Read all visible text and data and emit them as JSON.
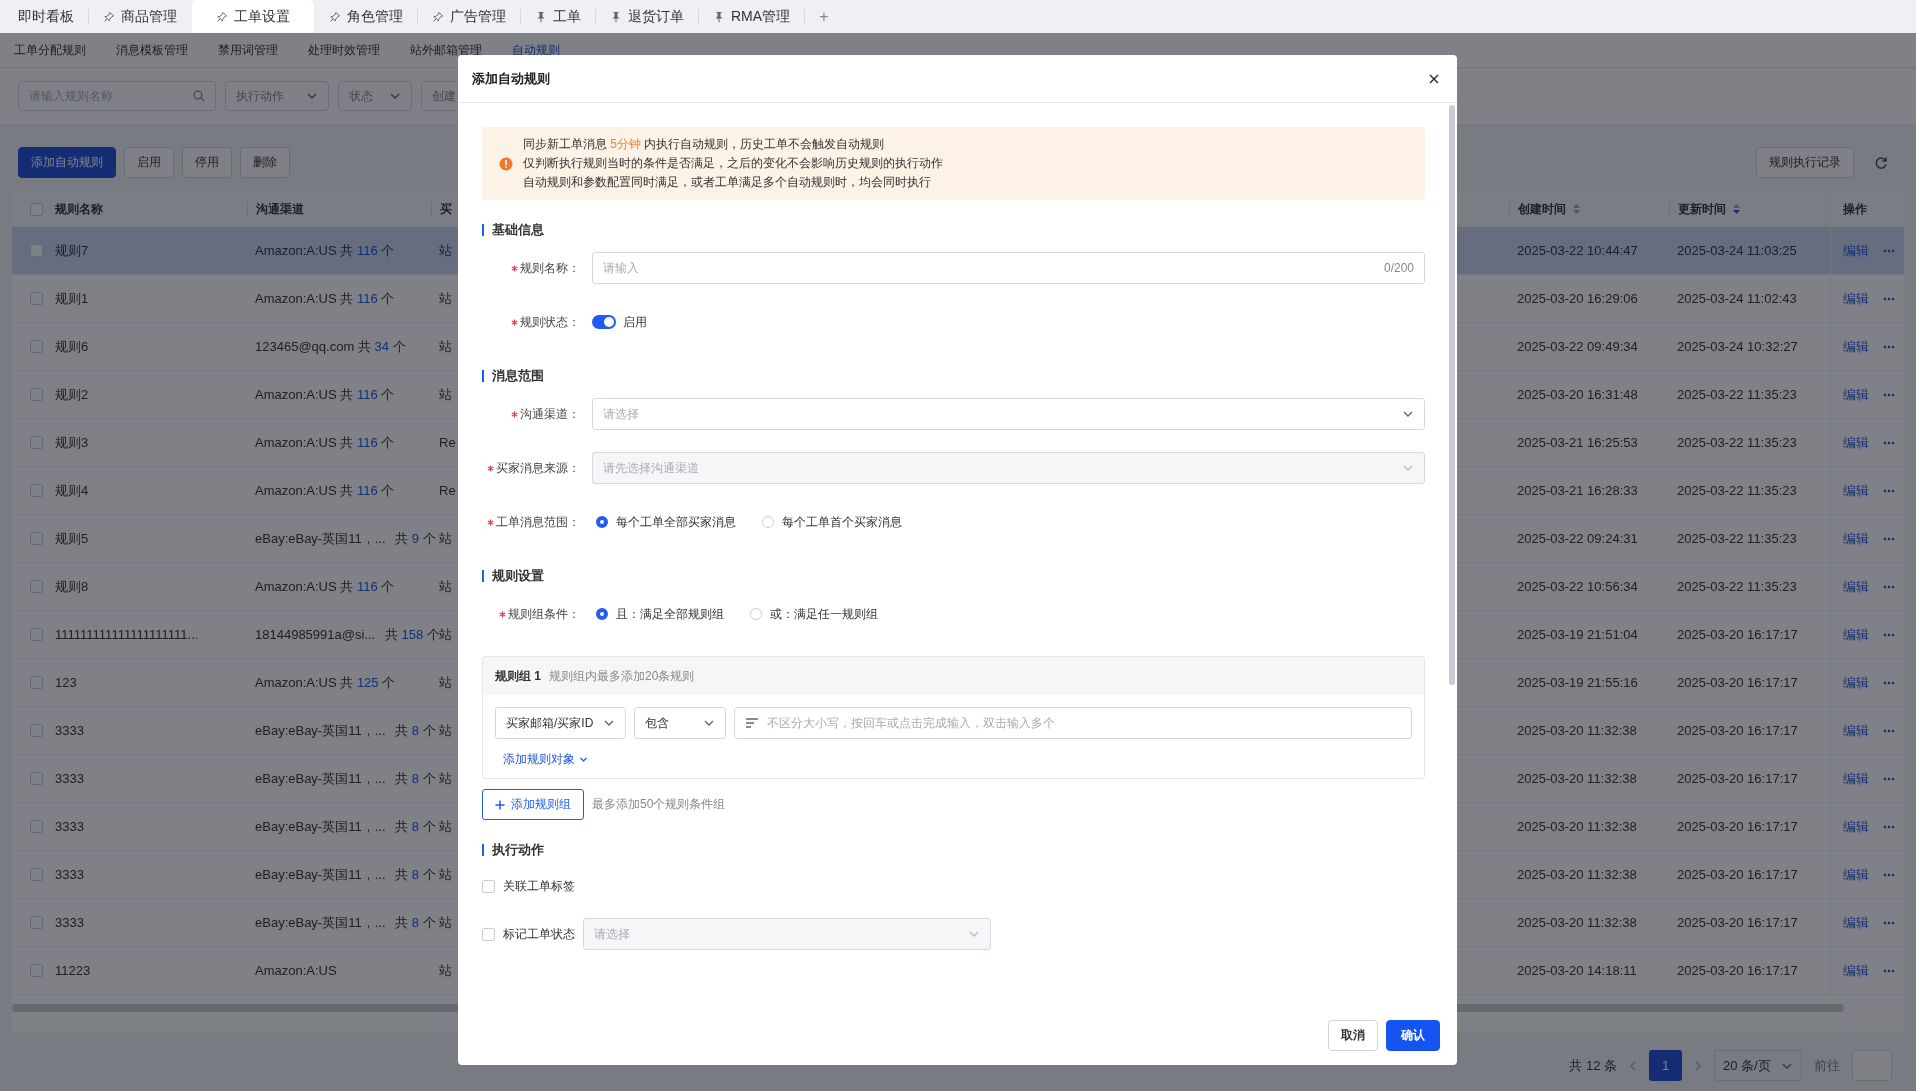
{
  "tabs": [
    {
      "label": "即时看板",
      "selected": false
    },
    {
      "label": "商品管理",
      "pinned": false,
      "selected": false
    },
    {
      "label": "工单设置",
      "pinned": false,
      "selected": true
    },
    {
      "label": "角色管理",
      "pinned": false,
      "selected": false
    },
    {
      "label": "广告管理",
      "pinned": false,
      "selected": false
    },
    {
      "label": "工单",
      "pinned": true,
      "selected": false
    },
    {
      "label": "退货订单",
      "pinned": true,
      "selected": false
    },
    {
      "label": "RMA管理",
      "pinned": true,
      "selected": false
    }
  ],
  "add_tab": "+",
  "subnav": [
    {
      "label": "工单分配规则",
      "selected": false
    },
    {
      "label": "消息模板管理",
      "selected": false
    },
    {
      "label": "禁用词管理",
      "selected": false
    },
    {
      "label": "处理时效管理",
      "selected": false
    },
    {
      "label": "站外邮箱管理",
      "selected": false
    },
    {
      "label": "自动规则",
      "selected": true
    }
  ],
  "filters": {
    "search": {
      "placeholder": "请输入规则名称"
    },
    "dropdowns": [
      {
        "placeholder": "执行动作"
      },
      {
        "placeholder": "状态"
      },
      {
        "placeholder": "创建",
        "cut_off": true
      }
    ]
  },
  "actions": {
    "buttons": [
      {
        "label": "添加自动规则",
        "kind": "primary"
      },
      {
        "label": "启用",
        "kind": "default"
      },
      {
        "label": "停用",
        "kind": "default"
      },
      {
        "label": "删除",
        "kind": "default"
      }
    ],
    "log_button": "规则执行记录"
  },
  "table": {
    "all_checked": false,
    "columns": [
      {
        "label": "规则名称"
      },
      {
        "label": "沟通渠道"
      },
      {
        "label": "买"
      },
      {
        "label": "创建时间",
        "sorted": false
      },
      {
        "label": "更新时间",
        "sorted": true
      },
      {
        "label": "操作"
      }
    ],
    "rows": [
      {
        "name": "规则7",
        "channel": "Amazon:A:US",
        "total": {
          "prefix": "共",
          "count": "116",
          "unit": "个"
        },
        "column_3": "站",
        "created": "2025-03-22 10:44:47",
        "updated": "2025-03-24 11:03:25",
        "edit": "编辑",
        "checked": false,
        "highlighted": true
      },
      {
        "name": "规则1",
        "channel": "Amazon:A:US",
        "total": {
          "prefix": "共",
          "count": "116",
          "unit": "个"
        },
        "column_3": "站",
        "created": "2025-03-20 16:29:06",
        "updated": "2025-03-24 11:02:43",
        "edit": "编辑",
        "checked": false,
        "highlighted": false
      },
      {
        "name": "规则6",
        "channel": "123465@qq.com",
        "total": {
          "prefix": "共",
          "count": "34",
          "unit": "个"
        },
        "column_3": "站",
        "created": "2025-03-22 09:49:34",
        "updated": "2025-03-24 10:32:27",
        "edit": "编辑",
        "checked": false,
        "highlighted": false
      },
      {
        "name": "规则2",
        "channel": "Amazon:A:US",
        "total": {
          "prefix": "共",
          "count": "116",
          "unit": "个"
        },
        "column_3": "站",
        "created": "2025-03-20 16:31:48",
        "updated": "2025-03-22 11:35:23",
        "edit": "编辑",
        "checked": false,
        "highlighted": false
      },
      {
        "name": "规则3",
        "channel": "Amazon:A:US",
        "total": {
          "prefix": "共",
          "count": "116",
          "unit": "个"
        },
        "column_3": "Re",
        "created": "2025-03-21 16:25:53",
        "updated": "2025-03-22 11:35:23",
        "edit": "编辑",
        "checked": false,
        "highlighted": false
      },
      {
        "name": "规则4",
        "channel": "Amazon:A:US",
        "total": {
          "prefix": "共",
          "count": "116",
          "unit": "个"
        },
        "column_3": "Re",
        "created": "2025-03-21 16:28:33",
        "updated": "2025-03-22 11:35:23",
        "edit": "编辑",
        "checked": false,
        "highlighted": false
      },
      {
        "name": "规则5",
        "channel": "eBay:eBay-英国11，...",
        "total": {
          "prefix": "共",
          "count": "9",
          "unit": "个"
        },
        "column_3": "站",
        "created": "2025-03-22 09:24:31",
        "updated": "2025-03-22 11:35:23",
        "edit": "编辑",
        "checked": false,
        "highlighted": false
      },
      {
        "name": "规则8",
        "channel": "Amazon:A:US",
        "total": {
          "prefix": "共",
          "count": "116",
          "unit": "个"
        },
        "column_3": "站",
        "created": "2025-03-22 10:56:34",
        "updated": "2025-03-22 11:35:23",
        "edit": "编辑",
        "checked": false,
        "highlighted": false
      },
      {
        "name": "111111111111111111111...",
        "channel": "18144985991a@si...",
        "total": {
          "prefix": "共",
          "count": "158",
          "unit": "个"
        },
        "column_3": "站",
        "created": "2025-03-19 21:51:04",
        "updated": "2025-03-20 16:17:17",
        "edit": "编辑",
        "checked": false,
        "highlighted": false
      },
      {
        "name": "123",
        "channel": "Amazon:A:US",
        "total": {
          "prefix": "共",
          "count": "125",
          "unit": "个"
        },
        "column_3": "站",
        "created": "2025-03-19 21:55:16",
        "updated": "2025-03-20 16:17:17",
        "edit": "编辑",
        "checked": false,
        "highlighted": false
      },
      {
        "name": "3333",
        "channel": "eBay:eBay-英国11，...",
        "total": {
          "prefix": "共",
          "count": "8",
          "unit": "个"
        },
        "column_3": "站",
        "created": "2025-03-20 11:32:38",
        "updated": "2025-03-20 16:17:17",
        "edit": "编辑",
        "checked": false,
        "highlighted": false
      },
      {
        "name": "3333",
        "channel": "eBay:eBay-英国11，...",
        "total": {
          "prefix": "共",
          "count": "8",
          "unit": "个"
        },
        "column_3": "站",
        "created": "2025-03-20 11:32:38",
        "updated": "2025-03-20 16:17:17",
        "edit": "编辑",
        "checked": false,
        "highlighted": false
      },
      {
        "name": "3333",
        "channel": "eBay:eBay-英国11，...",
        "total": {
          "prefix": "共",
          "count": "8",
          "unit": "个"
        },
        "column_3": "站",
        "created": "2025-03-20 11:32:38",
        "updated": "2025-03-20 16:17:17",
        "edit": "编辑",
        "checked": false,
        "highlighted": false
      },
      {
        "name": "3333",
        "channel": "eBay:eBay-英国11，...",
        "total": {
          "prefix": "共",
          "count": "8",
          "unit": "个"
        },
        "column_3": "站",
        "created": "2025-03-20 11:32:38",
        "updated": "2025-03-20 16:17:17",
        "edit": "编辑",
        "checked": false,
        "highlighted": false
      },
      {
        "name": "3333",
        "channel": "eBay:eBay-英国11，...",
        "total": {
          "prefix": "共",
          "count": "8",
          "unit": "个"
        },
        "column_3": "站",
        "created": "2025-03-20 11:32:38",
        "updated": "2025-03-20 16:17:17",
        "edit": "编辑",
        "checked": false,
        "highlighted": false
      },
      {
        "name": "11223",
        "channel": "Amazon:A:US",
        "column_3": "站",
        "created": "2025-03-20 14:18:11",
        "updated": "2025-03-20 16:17:17",
        "edit": "编辑",
        "checked": false,
        "highlighted": false
      }
    ]
  },
  "pagination": {
    "total": "共 12 条",
    "pages": [
      {
        "label": "1",
        "selected": true
      }
    ],
    "page_size": "20 条/页",
    "goto": "前往"
  },
  "dialog": {
    "title": "添加自动规则",
    "notice": [
      {
        "text": "同步新工单消息 ",
        "highlight": "5分钟",
        "after": " 内执行自动规则，历史工单不会触发自动规则"
      },
      {
        "text": "仅判断执行规则当时的条件是否满足，之后的变化不会影响历史规则的执行动作"
      },
      {
        "text": "自动规则和参数配置同时满足，或者工单满足多个自动规则时，均会同时执行"
      }
    ],
    "basic": {
      "title": "基础信息",
      "fields": [
        {
          "kind": "input",
          "label": "规则名称：",
          "required": true,
          "placeholder": "请输入",
          "counter": "0/200"
        },
        {
          "kind": "switch",
          "label": "规则状态：",
          "required": true,
          "on": true,
          "text": "启用"
        }
      ]
    },
    "scope": {
      "title": "消息范围",
      "fields": [
        {
          "kind": "select",
          "label": "沟通渠道：",
          "required": true,
          "placeholder": "请选择",
          "disabled": false
        },
        {
          "kind": "select",
          "label": "买家消息来源：",
          "required": true,
          "placeholder": "请先选择沟通渠道",
          "disabled": true
        },
        {
          "kind": "radio",
          "label": "工单消息范围：",
          "required": true,
          "options": [
            {
              "label": "每个工单全部买家消息",
              "selected": true
            },
            {
              "label": "每个工单首个买家消息",
              "selected": false
            }
          ]
        }
      ]
    },
    "rules": {
      "title": "规则设置",
      "fields": [
        {
          "kind": "radio",
          "label": "规则组条件：",
          "required": true,
          "options": [
            {
              "label": "且：满足全部规则组",
              "selected": true
            },
            {
              "label": "或：满足任一规则组",
              "selected": false
            }
          ]
        }
      ],
      "groups": [
        {
          "title": "规则组 1",
          "hint": "规则组内最多添加20条规则",
          "conditions": [
            {
              "field": "买家邮箱/买家ID",
              "operator": "包含",
              "placeholder": "不区分大小写，按回车或点击完成输入，双击输入多个"
            }
          ],
          "add_link": "添加规则对象"
        }
      ],
      "add_group": {
        "label": "添加规则组",
        "hint": "最多添加50个规则条件组"
      }
    },
    "actions": {
      "title": "执行动作",
      "items": [
        {
          "kind": "checkbox",
          "label": "关联工单标签",
          "checked": false
        },
        {
          "kind": "checkbox_select",
          "label": "标记工单状态",
          "checked": false,
          "placeholder": "请选择",
          "disabled": true
        }
      ]
    },
    "footer": [
      {
        "label": "取消",
        "kind": "default"
      },
      {
        "label": "确认",
        "kind": "primary"
      }
    ]
  }
}
